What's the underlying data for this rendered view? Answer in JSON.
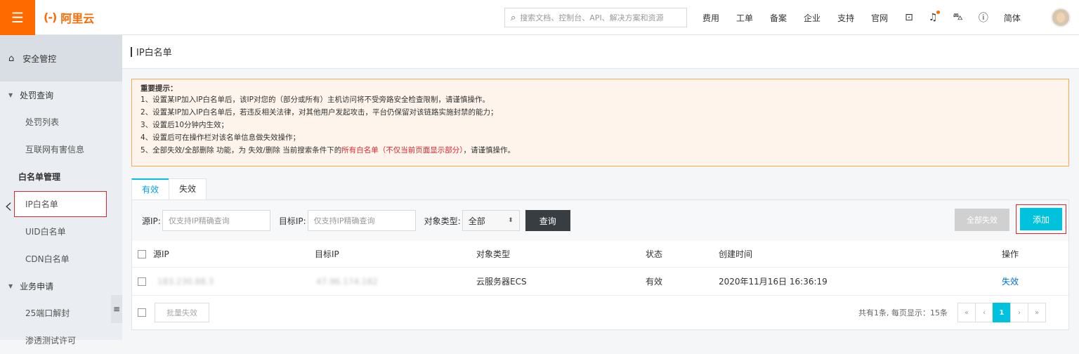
{
  "topbar": {
    "menu_icon": "☰",
    "logo_mark": "(-)",
    "logo_text": "阿里云",
    "search_placeholder": "搜索文档、控制台、API、解决方案和资源",
    "nav": [
      "费用",
      "工单",
      "备案",
      "企业",
      "支持",
      "官网"
    ],
    "lang": "简体"
  },
  "sidebar": {
    "header": "安全管控",
    "groups": [
      {
        "label": "处罚查询",
        "items": [
          "处罚列表",
          "互联网有害信息"
        ]
      },
      {
        "label": "白名单管理",
        "items": [
          "IP白名单",
          "UID白名单",
          "CDN白名单"
        ]
      },
      {
        "label": "业务申请",
        "items": [
          "25端口解封",
          "渗透测试许可"
        ]
      }
    ],
    "active_item": "IP白名单"
  },
  "page": {
    "title": "IP白名单"
  },
  "notice": {
    "title": "重要提示：",
    "lines": [
      "1、设置某IP加入IP白名单后，该IP对您的（部分或所有）主机访问将不受旁路安全检查限制，请谨慎操作。",
      "2、设置某IP加入IP白名单后，若违反相关法律，对其他用户发起攻击，平台仍保留对该链路实施封禁的能力；",
      "3、设置后10分钟内生效；",
      "4、设置后可在操作栏对该名单信息做失效操作；"
    ],
    "line5_a": "5、全部失效/全部删除 功能，为 失效/删除 当前搜索条件下的",
    "line5_red": "所有白名单（不仅当前页面显示部分）",
    "line5_b": "，请谨慎操作。"
  },
  "tabs": [
    "有效",
    "失效"
  ],
  "filters": {
    "src_label": "源IP:",
    "src_placeholder": "仅支持IP精确查询",
    "dst_label": "目标IP:",
    "dst_placeholder": "仅支持IP精确查询",
    "type_label": "对象类型:",
    "type_value": "全部",
    "query_btn": "查询",
    "disable_all_btn": "全部失效",
    "add_btn": "添加"
  },
  "table": {
    "headers": [
      "源IP",
      "目标IP",
      "对象类型",
      "状态",
      "创建时间",
      "操作"
    ],
    "rows": [
      {
        "src": "183.230.88.3",
        "dst": "47.96.174.182",
        "type": "云服务器ECS",
        "status": "有效",
        "created": "2020年11月16日 16:36:19",
        "action": "失效"
      }
    ]
  },
  "footer": {
    "batch_btn": "批量失效",
    "summary": "共有1条, 每页显示：15条",
    "pager": [
      "«",
      "‹",
      "1",
      "›",
      "»"
    ]
  },
  "colors": {
    "brand": "#ff6a00",
    "accent": "#00c1de",
    "highlight": "#e0262d"
  }
}
